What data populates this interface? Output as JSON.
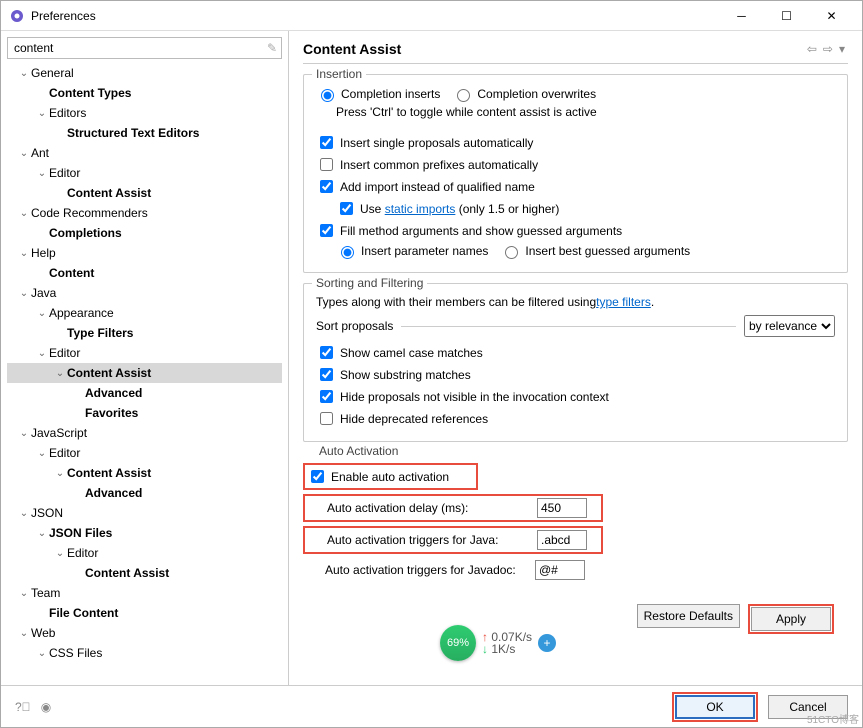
{
  "window": {
    "title": "Preferences"
  },
  "search": {
    "value": "content"
  },
  "tree": [
    {
      "d": 0,
      "tw": "v",
      "label": "General",
      "bold": false
    },
    {
      "d": 1,
      "tw": "",
      "label": "Content Types",
      "bold": true
    },
    {
      "d": 1,
      "tw": "v",
      "label": "Editors",
      "bold": false
    },
    {
      "d": 2,
      "tw": "",
      "label": "Structured Text Editors",
      "bold": true
    },
    {
      "d": 0,
      "tw": "v",
      "label": "Ant",
      "bold": false
    },
    {
      "d": 1,
      "tw": "v",
      "label": "Editor",
      "bold": false
    },
    {
      "d": 2,
      "tw": "",
      "label": "Content Assist",
      "bold": true
    },
    {
      "d": 0,
      "tw": "v",
      "label": "Code Recommenders",
      "bold": false
    },
    {
      "d": 1,
      "tw": "",
      "label": "Completions",
      "bold": true
    },
    {
      "d": 0,
      "tw": "v",
      "label": "Help",
      "bold": false
    },
    {
      "d": 1,
      "tw": "",
      "label": "Content",
      "bold": true
    },
    {
      "d": 0,
      "tw": "v",
      "label": "Java",
      "bold": false
    },
    {
      "d": 1,
      "tw": "v",
      "label": "Appearance",
      "bold": false
    },
    {
      "d": 2,
      "tw": "",
      "label": "Type Filters",
      "bold": true
    },
    {
      "d": 1,
      "tw": "v",
      "label": "Editor",
      "bold": false
    },
    {
      "d": 2,
      "tw": "v",
      "label": "Content Assist",
      "bold": true,
      "sel": true
    },
    {
      "d": 3,
      "tw": "",
      "label": "Advanced",
      "bold": true
    },
    {
      "d": 3,
      "tw": "",
      "label": "Favorites",
      "bold": true
    },
    {
      "d": 0,
      "tw": "v",
      "label": "JavaScript",
      "bold": false
    },
    {
      "d": 1,
      "tw": "v",
      "label": "Editor",
      "bold": false
    },
    {
      "d": 2,
      "tw": "v",
      "label": "Content Assist",
      "bold": true
    },
    {
      "d": 3,
      "tw": "",
      "label": "Advanced",
      "bold": true
    },
    {
      "d": 0,
      "tw": "v",
      "label": "JSON",
      "bold": false
    },
    {
      "d": 1,
      "tw": "v",
      "label": "JSON Files",
      "bold": true
    },
    {
      "d": 2,
      "tw": "v",
      "label": "Editor",
      "bold": false
    },
    {
      "d": 3,
      "tw": "",
      "label": "Content Assist",
      "bold": true
    },
    {
      "d": 0,
      "tw": "v",
      "label": "Team",
      "bold": false
    },
    {
      "d": 1,
      "tw": "",
      "label": "File Content",
      "bold": true
    },
    {
      "d": 0,
      "tw": "v",
      "label": "Web",
      "bold": false
    },
    {
      "d": 1,
      "tw": "v",
      "label": "CSS Files",
      "bold": false
    }
  ],
  "page": {
    "title": "Content Assist",
    "insertion": {
      "title": "Insertion",
      "r1": "Completion inserts",
      "r2": "Completion overwrites",
      "hint": "Press 'Ctrl' to toggle while content assist is active",
      "c1": "Insert single proposals automatically",
      "c2": "Insert common prefixes automatically",
      "c3": "Add import instead of qualified name",
      "c3a_pre": "Use ",
      "c3a_link": "static imports",
      "c3a_post": " (only 1.5 or higher)",
      "c4": "Fill method arguments and show guessed arguments",
      "r3": "Insert parameter names",
      "r4": "Insert best guessed arguments"
    },
    "sorting": {
      "title": "Sorting and Filtering",
      "desc_pre": "Types along with their members can be filtered using ",
      "desc_link": "type filters",
      "desc_post": ".",
      "sort_label": "Sort proposals",
      "sort_value": "by relevance",
      "c1": "Show camel case matches",
      "c2": "Show substring matches",
      "c3": "Hide proposals not visible in the invocation context",
      "c4": "Hide deprecated references"
    },
    "auto": {
      "title": "Auto Activation",
      "enable": "Enable auto activation",
      "delay_label": "Auto activation delay (ms):",
      "delay_value": "450",
      "java_label": "Auto activation triggers for Java:",
      "java_value": ".abcd",
      "javadoc_label": "Auto activation triggers for Javadoc:",
      "javadoc_value": "@#"
    }
  },
  "widget": {
    "percent": "69%",
    "up": "0.07K/s",
    "down": "1K/s"
  },
  "buttons": {
    "restore": "Restore Defaults",
    "apply": "Apply",
    "ok": "OK",
    "cancel": "Cancel"
  },
  "watermark": "51CTO博客"
}
